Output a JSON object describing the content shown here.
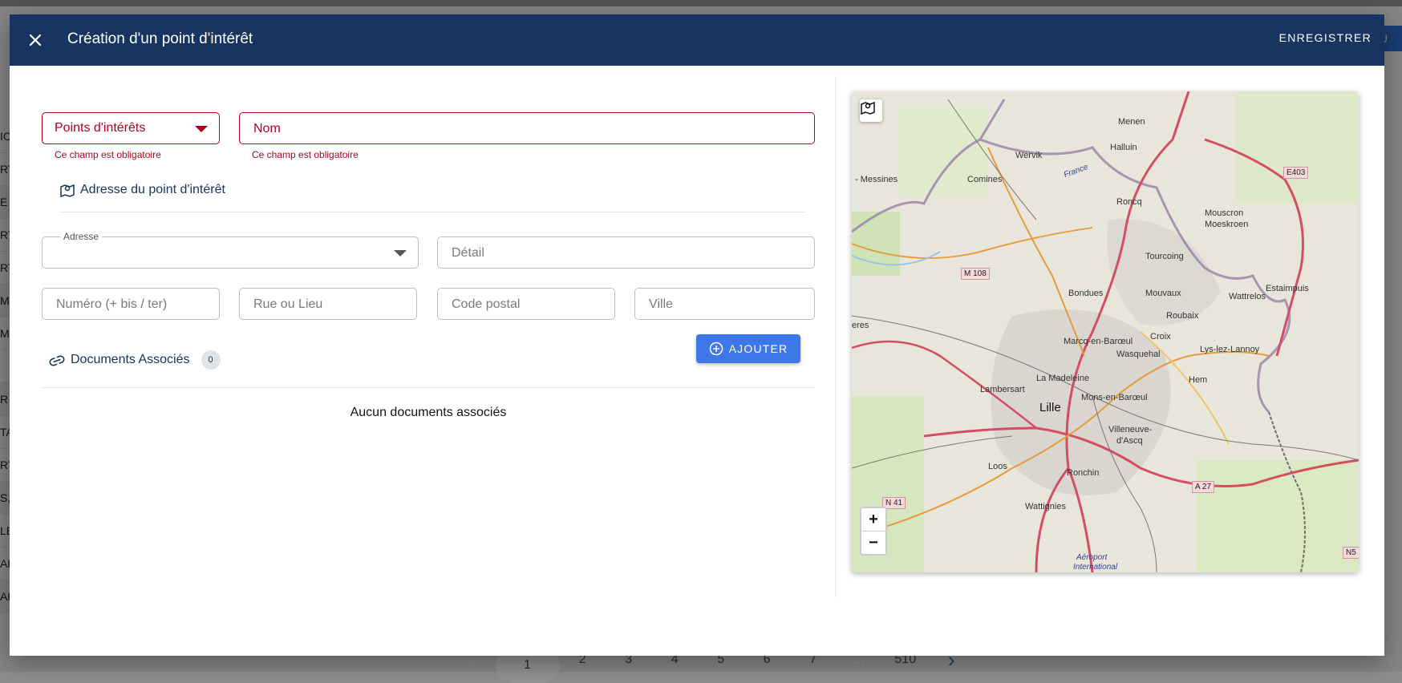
{
  "background": {
    "row_fragments": [
      "IC",
      "RT",
      "E",
      "RT",
      "RT",
      "MA",
      "MA",
      "",
      "R",
      "TA",
      "RT",
      "S,",
      "LE",
      "AF",
      "AF"
    ],
    "top_button_label": "OU",
    "pagination": {
      "prev": "‹",
      "pages": [
        "1",
        "2",
        "3",
        "4",
        "5",
        "6",
        "7",
        "…",
        "510"
      ],
      "active_page": "1",
      "next": "›"
    }
  },
  "dialog": {
    "title": "Création d'un point d'intérêt",
    "save_label": "ENREGISTRER",
    "close_icon": "close-icon",
    "form": {
      "type_select": {
        "value": "Points d'intérêts",
        "error": "Ce champ est obligatoire"
      },
      "name_field": {
        "placeholder": "Nom",
        "error": "Ce champ est obligatoire"
      },
      "address_section_title": "Adresse du point d'intérêt",
      "address_select": {
        "legend": "Adresse",
        "value": ""
      },
      "detail_field": {
        "placeholder": "Détail"
      },
      "number_field": {
        "placeholder": "Numéro (+ bis / ter)"
      },
      "street_field": {
        "placeholder": "Rue ou Lieu"
      },
      "postal_field": {
        "placeholder": "Code postal"
      },
      "city_field": {
        "placeholder": "Ville"
      },
      "documents": {
        "title": "Documents Associés",
        "count": "0",
        "add_label": "AJOUTER",
        "empty_message": "Aucun documents associés"
      }
    },
    "map": {
      "labels": [
        "Menen",
        "Wervik",
        "Halluin",
        "Comines",
        "- Messines",
        "Roncq",
        "Mouscron",
        "Moeskroen",
        "Tourcoing",
        "Bondues",
        "Mouvaux",
        "Wattrelos",
        "Estaimpuis",
        "Roubaix",
        "Marcq-en-Barœul",
        "Croix",
        "Wasquehal",
        "Lys-lez-Lannoy",
        "La Madeleine",
        "Lambersart",
        "Mons-en-Barœul",
        "Hem",
        "Lille",
        "Villeneuve-",
        "d'Ascq",
        "Loos",
        "Ronchin",
        "Wattignies",
        "Aéroport",
        "International",
        "France",
        "eres"
      ],
      "road_shields": [
        "E403",
        "M 108",
        "A 27",
        "N 41",
        "N5"
      ],
      "zoom_in": "+",
      "zoom_out": "−"
    }
  }
}
